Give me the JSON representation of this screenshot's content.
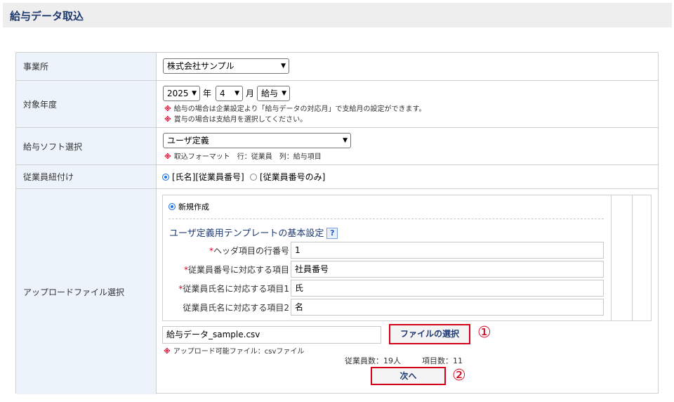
{
  "page": {
    "title": "給与データ取込"
  },
  "rows": {
    "office": {
      "label": "事業所",
      "select_value": "株式会社サンプル"
    },
    "year": {
      "label": "対象年度",
      "year_value": "2025",
      "year_unit": "年",
      "month_value": "4",
      "month_unit": "月",
      "type_value": "給与",
      "note1": "給与の場合は企業設定より「給与データの対応月」で支給月の設定ができます。",
      "note2": "賞与の場合は支給月を選択してください。"
    },
    "software": {
      "label": "給与ソフト選択",
      "select_value": "ユーザ定義",
      "note": "取込フォーマット　行：従業員　列：給与項目"
    },
    "link": {
      "label": "従業員紐付け",
      "option1": "[氏名][従業員番号]",
      "option2": "[従業員番号のみ]"
    },
    "upload": {
      "label": "アップロードファイル選択",
      "new_label": "新規作成",
      "template_title": "ユーザ定義用テンプレートの基本設定",
      "help": "?",
      "fields": [
        {
          "required": "*",
          "label": "ヘッダ項目の行番号",
          "value": "1"
        },
        {
          "required": "*",
          "label": "従業員番号に対応する項目",
          "value": "社員番号"
        },
        {
          "required": "*",
          "label": "従業員氏名に対応する項目1",
          "value": "氏"
        },
        {
          "required": "",
          "label": "従業員氏名に対応する項目2",
          "value": "名"
        }
      ],
      "file_name": "給与データ_sample.csv",
      "choose_button": "ファイルの選択",
      "callout1": "①",
      "file_note": "アップロード可能ファイル：csvファイル",
      "employee_count": "従業員数：19人",
      "item_count": "項目数：11",
      "next_button": "次へ",
      "callout2": "②"
    }
  },
  "note_mark": "※",
  "accent_color": "#d4001a"
}
